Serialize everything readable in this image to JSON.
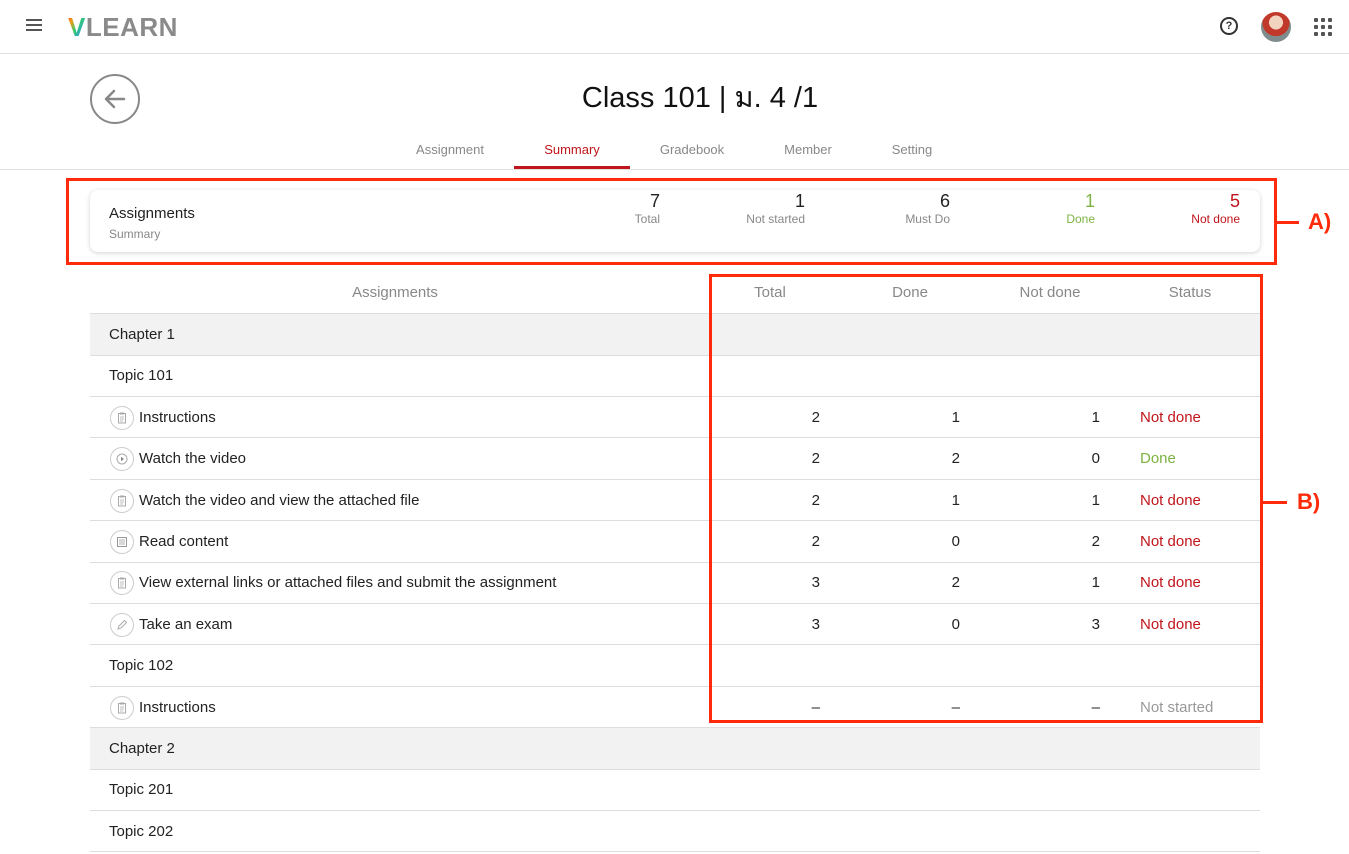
{
  "app": {
    "logo_v": "V",
    "logo_rest": "LEARN"
  },
  "header": {
    "title": "Class 101 | ม. 4 /1",
    "help_glyph": "?"
  },
  "tabs": [
    {
      "label": "Assignment"
    },
    {
      "label": "Summary"
    },
    {
      "label": "Gradebook"
    },
    {
      "label": "Member"
    },
    {
      "label": "Setting"
    }
  ],
  "summary": {
    "title": "Assignments",
    "subtitle": "Summary",
    "stats": [
      {
        "value": "7",
        "label": "Total"
      },
      {
        "value": "1",
        "label": "Not started"
      },
      {
        "value": "6",
        "label": "Must Do"
      },
      {
        "value": "1",
        "label": "Done"
      },
      {
        "value": "5",
        "label": "Not done"
      }
    ]
  },
  "table": {
    "headers": [
      "Assignments",
      "Total",
      "Done",
      "Not done",
      "Status"
    ],
    "rows": [
      {
        "type": "chapter",
        "label": "Chapter 1"
      },
      {
        "type": "topic",
        "label": "Topic 101"
      },
      {
        "type": "item",
        "icon": "clipboard-icon",
        "label": "Instructions",
        "total": "2",
        "done": "1",
        "not_done": "1",
        "status": "Not done"
      },
      {
        "type": "item",
        "icon": "play-icon",
        "label": "Watch the video",
        "total": "2",
        "done": "2",
        "not_done": "0",
        "status": "Done"
      },
      {
        "type": "item",
        "icon": "clipboard-icon",
        "label": "Watch the video and view the attached file",
        "total": "2",
        "done": "1",
        "not_done": "1",
        "status": "Not done"
      },
      {
        "type": "item",
        "icon": "document-icon",
        "label": "Read content",
        "total": "2",
        "done": "0",
        "not_done": "2",
        "status": "Not done"
      },
      {
        "type": "item",
        "icon": "clipboard-icon",
        "label": "View external links or attached files and submit the assignment",
        "total": "3",
        "done": "2",
        "not_done": "1",
        "status": "Not done"
      },
      {
        "type": "item",
        "icon": "pencil-icon",
        "label": "Take an exam",
        "total": "3",
        "done": "0",
        "not_done": "3",
        "status": "Not done"
      },
      {
        "type": "topic",
        "label": "Topic 102"
      },
      {
        "type": "item",
        "icon": "clipboard-icon",
        "label": "Instructions",
        "total": "–",
        "done": "–",
        "not_done": "–",
        "status": "Not started"
      },
      {
        "type": "chapter",
        "label": "Chapter 2"
      },
      {
        "type": "topic",
        "label": "Topic 201"
      },
      {
        "type": "topic",
        "label": "Topic 202"
      }
    ]
  },
  "annotations": {
    "a": "A)",
    "b": "B)"
  },
  "colors": {
    "accent": "#c0151b",
    "done": "#7cb342",
    "annotation": "#ff2a0a"
  }
}
